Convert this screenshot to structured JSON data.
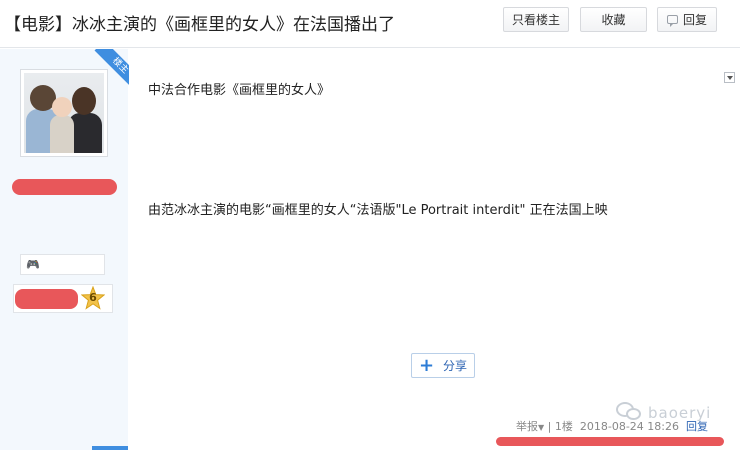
{
  "thread": {
    "title": "【电影】冰冰主演的《画框里的女人》在法国播出了",
    "buttons": {
      "only_op": "只看楼主",
      "favorite": "收藏",
      "reply": "回复"
    }
  },
  "author": {
    "op_badge": "楼主",
    "level": "6"
  },
  "post": {
    "paragraphs": [
      "中法合作电影《画框里的女人》",
      "由范冰冰主演的电影“画框里的女人“法语版\"Le Portrait interdit\" 正在法国上映"
    ],
    "share_label": "分享"
  },
  "footer": {
    "report": "举报",
    "separator": "|",
    "floor": "1楼",
    "datetime": "2018-08-24 18:26",
    "reply": "回复"
  },
  "watermark": "baoeryi",
  "colors": {
    "accent_blue": "#3f8ee0",
    "redaction": "#e8575a",
    "sidebar_bg": "#f3f8fd"
  },
  "icons": [
    "reply-icon",
    "gamepad-icon",
    "star-level-icon",
    "dropdown-icon",
    "share-plus-icon",
    "wechat-icon"
  ]
}
